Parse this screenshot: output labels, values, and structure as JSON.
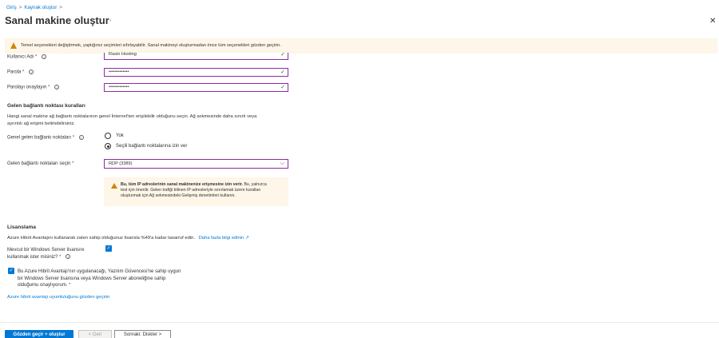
{
  "breadcrumb": {
    "home": "Giriş",
    "sep1": ">",
    "create": "Kaynak oluştur",
    "sep2": ">"
  },
  "page": {
    "title": "Sanal makine oluştur",
    "more": "···",
    "close": "✕"
  },
  "banner": {
    "text": "Temel seçenekleri değiştirmek, yaptığınız seçimleri sıfırlayabilir. Sanal makineyi oluşturmadan önce tüm seçenekleri gözden geçirin."
  },
  "fields": {
    "username": {
      "label": "Kullanıcı Adı",
      "value": "Rasin Hosting"
    },
    "password": {
      "label": "Parola",
      "value": "•••••••••••••"
    },
    "confirm": {
      "label": "Parolayı onaylayın",
      "value": "•••••••••••••"
    }
  },
  "inbound": {
    "heading": "Gelen bağlantı noktası kuralları",
    "desc_line1": "Hangi sanal makine ağ bağlantı noktalarının genel İnternet'ten erişilebilir olduğunu seçin. Ağ sekmesinde daha sınırlı veya",
    "desc_line2": "ayrıntılı ağ erişimi belirtebilirsiniz.",
    "public_label": "Genel gelen bağlantı noktaları",
    "option_none": "Yok",
    "option_selected": "Seçili bağlantı noktalarına izin ver",
    "select_label": "Gelen bağlantı noktaları seçin",
    "select_value": "RDP (3389)",
    "warn_bold": "Bu, tüm IP adreslerinin sanal makinenize erişmesine izin verir.",
    "warn_line1_rest": " Bu, yalnızca",
    "warn_line2": "test için önerilir.  Gelen trafiği bilinen IP adresleriyle sınırlamak üzere kuralları",
    "warn_line3": "oluşturmak için Ağ sekmesindeki Gelişmiş denetimleri kullanın."
  },
  "licensing": {
    "heading": "Lisanslama",
    "desc": "Azure Hibrit Avantajını kullanarak zaten sahip olduğunuz lisansla %49'a kadar tasarruf edin.",
    "learn_more": "Daha fazla bilgi edinin",
    "existing_label_1": "Mevcut bir Windows Server lisansını",
    "existing_label_2": "kullanmak ister misiniz?",
    "confirm_line1": "Bu Azure Hibrit Avantajı'nın uygulanacağı, Yazılım Güvencesi'ne sahip uygun",
    "confirm_line2": "bir Windows Server lisansına veya Windows Server aboneliğine sahip",
    "confirm_line3": "olduğumu onaylıyorum.",
    "review_link": "Azure hibrit avantajı uyumluluğunu gözden geçirin"
  },
  "footer": {
    "review_create": "Gözden geçir + oluştur",
    "prev": "< Geri",
    "next": "Sonraki: Diskler >"
  },
  "colors": {
    "accent": "#0078d4",
    "warning": "#d28408",
    "input_border": "#8a2da5",
    "valid": "#107c10"
  }
}
